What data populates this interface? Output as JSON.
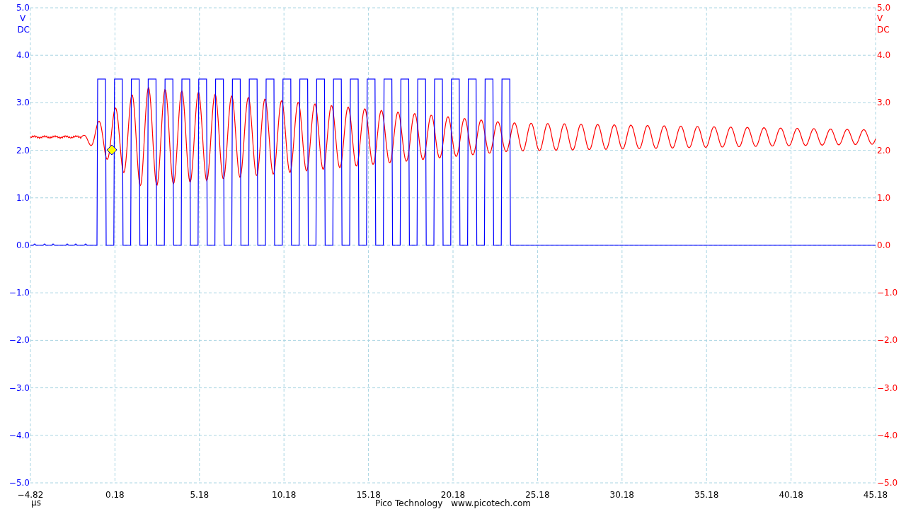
{
  "channels": [
    {
      "kind": "square",
      "color": "#0000ff",
      "unit": "V",
      "coupling": "DC",
      "labels": [
        "5.0",
        "4.0",
        "3.0",
        "2.0",
        "1.0",
        "0.0",
        "−1.0",
        "−2.0",
        "−3.0",
        "−4.0",
        "−5.0"
      ]
    },
    {
      "kind": "decaying-sine",
      "color": "#ff0000",
      "unit": "V",
      "coupling": "DC",
      "labels": [
        "5.0",
        "4.0",
        "3.0",
        "2.0",
        "1.0",
        "0.0",
        "−1.0",
        "−2.0",
        "−3.0",
        "−4.0",
        "−5.0"
      ]
    }
  ],
  "x_axis": {
    "unit": "µs",
    "labels": [
      "−4.82",
      "0.18",
      "5.18",
      "10.18",
      "15.18",
      "20.18",
      "25.18",
      "30.18",
      "35.18",
      "40.18",
      "45.18"
    ]
  },
  "footer": {
    "company": "Pico Technology",
    "website": "www.picotech.com"
  }
}
